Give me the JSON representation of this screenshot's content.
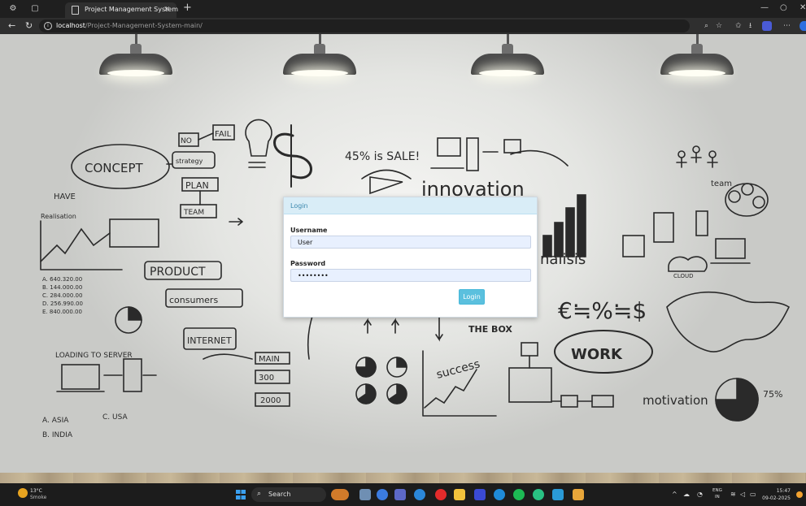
{
  "browser": {
    "tab_title": "Project Management System",
    "tab_close": "×",
    "new_tab": "+",
    "url_host": "localhost",
    "url_path": "/Project-Management-System-main/"
  },
  "modal": {
    "title": "Login",
    "username_label": "Username",
    "username_value": "User",
    "password_label": "Password",
    "password_value": "••••••••",
    "login_button": "Login"
  },
  "board": {
    "concept": "CONCEPT",
    "no": "NO",
    "fail": "FAIL",
    "strategy": "strategy",
    "plan": "PLAN",
    "team": "TEAM",
    "sale": "45% is SALE!",
    "innovation": "innovation",
    "product": "PRODUCT",
    "consumers": "consumers",
    "internet": "INTERNET",
    "main": "MAIN",
    "main_value": "300",
    "loading": "LOADING TO SERVER",
    "asia": "A. ASIA",
    "usa": "C. USA",
    "india": "B. INDIA",
    "the_box": "THE BOX",
    "success": "success",
    "work": "WORK",
    "motivation": "motivation",
    "pct_75": "75%",
    "cloud": "CLOUD",
    "currency": "€≒%≒$",
    "analysis": "nalisis",
    "team_label": "team",
    "have": "HAVE",
    "realisation": "Realisation",
    "y2000": "2000",
    "numbers": [
      "A. 640.320.00",
      "B. 144.000.00",
      "C. 284.000.00",
      "D. 256.990.00",
      "E. 840.000.00"
    ]
  },
  "taskbar": {
    "temp": "13°C",
    "weather": "Smoke",
    "search": "Search",
    "lang_top": "ENG",
    "lang_bottom": "IN",
    "time": "15:47",
    "date": "09-02-2025"
  }
}
